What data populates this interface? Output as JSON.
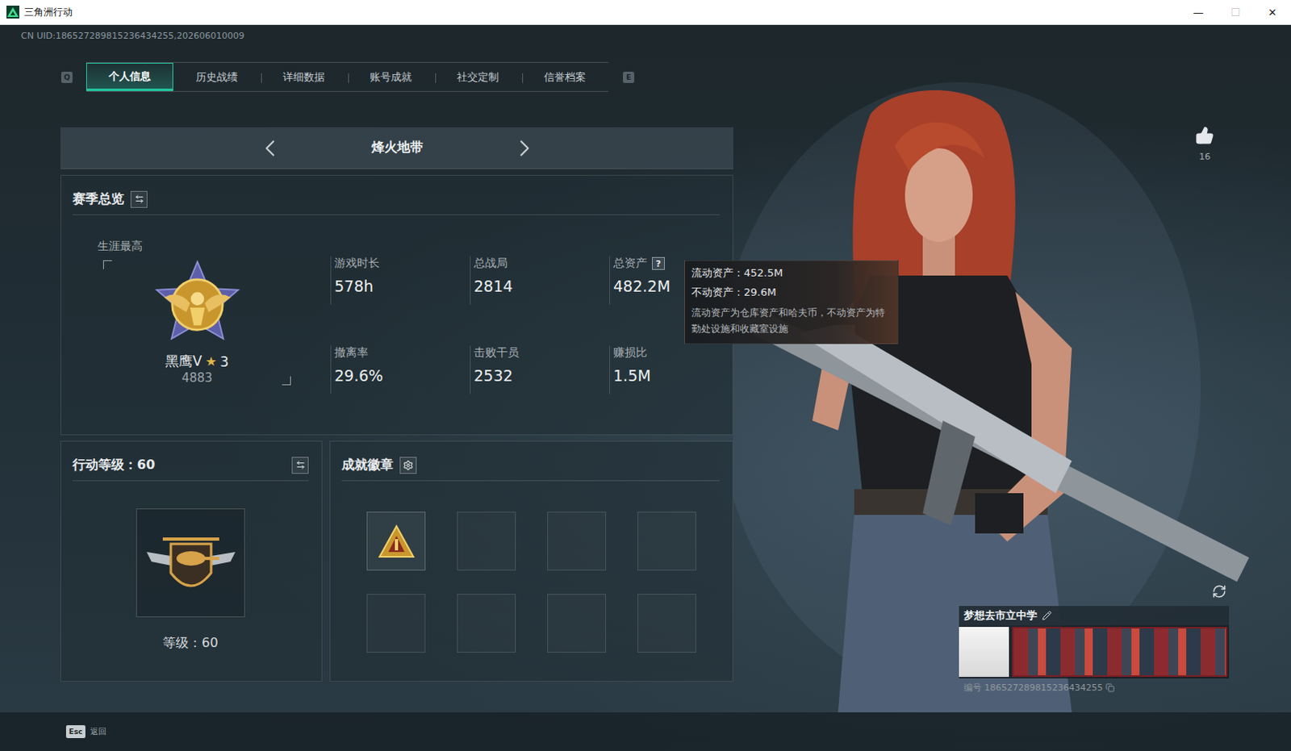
{
  "window": {
    "title": "三角洲行动",
    "controls": [
      {
        "glyph": "—",
        "disabled": false
      },
      {
        "glyph": "☐",
        "disabled": true
      },
      {
        "glyph": "✕",
        "disabled": false
      }
    ]
  },
  "uid": "CN UID:186527289815236434255,202606010009",
  "tabs": {
    "prev_key": "Q",
    "next_key": "E",
    "items": [
      {
        "label": "个人信息",
        "selected": true
      },
      {
        "label": "历史战绩",
        "selected": false
      },
      {
        "label": "详细数据",
        "selected": false
      },
      {
        "label": "账号成就",
        "selected": false
      },
      {
        "label": "社交定制",
        "selected": false
      },
      {
        "label": "信誉档案",
        "selected": false
      }
    ]
  },
  "mode": {
    "label": "烽火地带"
  },
  "season": {
    "title": "赛季总览",
    "rank": {
      "caption": "生涯最高",
      "name": "黑鹰V",
      "star": "★",
      "stars_text": "3",
      "score": "4883"
    },
    "stats": [
      {
        "label": "游戏时长",
        "value": "578h",
        "help": ""
      },
      {
        "label": "总战局",
        "value": "2814",
        "help": ""
      },
      {
        "label": "总资产",
        "value": "482.2M",
        "help": "?"
      },
      {
        "label": "撤离率",
        "value": "29.6%",
        "help": ""
      },
      {
        "label": "击败干员",
        "value": "2532",
        "help": ""
      },
      {
        "label": "赚损比",
        "value": "1.5M",
        "help": ""
      }
    ]
  },
  "tooltip": {
    "lines": [
      "流动资产：452.5M",
      "不动资产：29.6M"
    ],
    "note": "流动资产为仓库资产和哈夫币，不动资产为特勤处设施和收藏室设施"
  },
  "level": {
    "title": "行动等级：60",
    "caption": "等级：60"
  },
  "medals": {
    "title": "成就徽章",
    "slots": [
      {
        "filled": true
      },
      {
        "filled": false
      },
      {
        "filled": false
      },
      {
        "filled": false
      },
      {
        "filled": false
      },
      {
        "filled": false
      },
      {
        "filled": false
      },
      {
        "filled": false
      }
    ]
  },
  "likes": {
    "count": "16"
  },
  "profile": {
    "name": "梦想去市立中学",
    "id_text": "编号 186527289815236434255"
  },
  "footer": {
    "key": "Esc",
    "label": "返回"
  }
}
